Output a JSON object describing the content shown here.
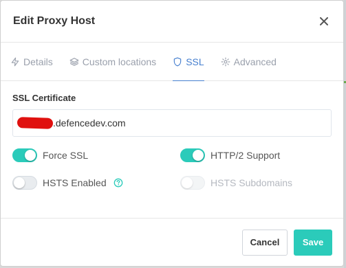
{
  "modal": {
    "title": "Edit Proxy Host"
  },
  "tabs": [
    {
      "label": "Details",
      "icon": "bolt-icon"
    },
    {
      "label": "Custom locations",
      "icon": "layers-icon"
    },
    {
      "label": "SSL",
      "icon": "shield-icon",
      "active": true
    },
    {
      "label": "Advanced",
      "icon": "gear-icon"
    }
  ],
  "ssl": {
    "certificate_label": "SSL Certificate",
    "certificate_value": ".defencedev.com",
    "force_ssl": {
      "label": "Force SSL",
      "enabled": true
    },
    "http2": {
      "label": "HTTP/2 Support",
      "enabled": true
    },
    "hsts": {
      "label": "HSTS Enabled",
      "enabled": false
    },
    "hsts_subdomains": {
      "label": "HSTS Subdomains",
      "enabled": false,
      "disabled": true
    }
  },
  "footer": {
    "cancel_label": "Cancel",
    "save_label": "Save"
  },
  "colors": {
    "accent_teal": "#2bcbba",
    "active_tab_blue": "#467fcf",
    "redaction_red": "#e0110f"
  }
}
